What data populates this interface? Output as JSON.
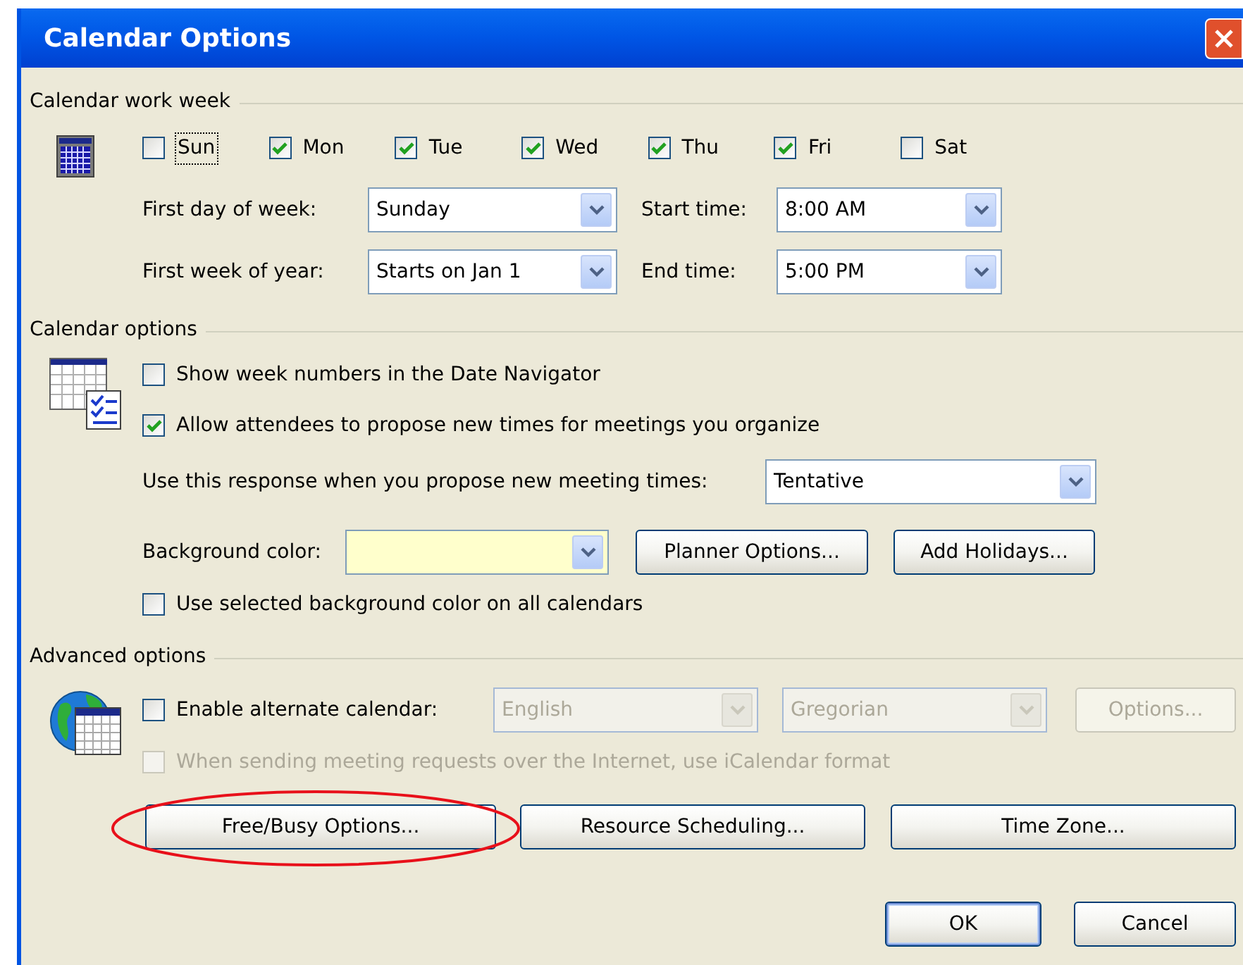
{
  "window": {
    "title": "Calendar Options"
  },
  "work_week": {
    "title": "Calendar work week",
    "days": [
      {
        "label": "Sun",
        "checked": false,
        "focused": true
      },
      {
        "label": "Mon",
        "checked": true,
        "focused": false
      },
      {
        "label": "Tue",
        "checked": true,
        "focused": false
      },
      {
        "label": "Wed",
        "checked": true,
        "focused": false
      },
      {
        "label": "Thu",
        "checked": true,
        "focused": false
      },
      {
        "label": "Fri",
        "checked": true,
        "focused": false
      },
      {
        "label": "Sat",
        "checked": false,
        "focused": false
      }
    ],
    "fields": [
      {
        "label": "First day of week:",
        "value": "Sunday"
      },
      {
        "label": "Start time:",
        "value": "8:00 AM"
      },
      {
        "label": "First week of year:",
        "value": "Starts on Jan 1"
      },
      {
        "label": "End time:",
        "value": "5:00 PM"
      }
    ]
  },
  "calendar_options": {
    "title": "Calendar options",
    "checkboxes": [
      {
        "label": "Show week numbers in the Date Navigator",
        "checked": false
      },
      {
        "label": "Allow attendees to propose new times for meetings you organize",
        "checked": true
      }
    ],
    "response": {
      "label": "Use this response when you propose new meeting times:",
      "value": "Tentative"
    },
    "background_color": {
      "label": "Background color:"
    },
    "buttons": [
      {
        "label": "Planner Options..."
      },
      {
        "label": "Add Holidays..."
      }
    ],
    "use_selected": {
      "label": "Use selected background color on all calendars",
      "checked": false
    }
  },
  "advanced_options": {
    "title": "Advanced options",
    "alternate_calendar": {
      "label": "Enable alternate calendar:",
      "checked": false
    },
    "language": {
      "value": "English",
      "disabled": true
    },
    "calendar_type": {
      "value": "Gregorian",
      "disabled": true
    },
    "options_button": {
      "label": "Options...",
      "disabled": true
    },
    "icalendar": {
      "label": "When sending meeting requests over the Internet, use iCalendar format",
      "checked": false,
      "disabled": true
    },
    "buttons": [
      {
        "label": "Free/Busy Options...",
        "highlighted": true
      },
      {
        "label": "Resource Scheduling...",
        "highlighted": false
      },
      {
        "label": "Time Zone...",
        "highlighted": false
      }
    ]
  },
  "footer_buttons": [
    {
      "label": "OK",
      "default": true
    },
    {
      "label": "Cancel",
      "default": false
    }
  ]
}
